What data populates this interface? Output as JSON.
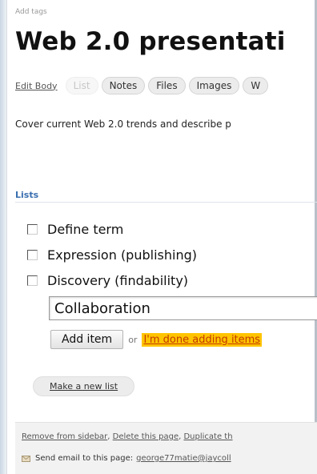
{
  "header": {
    "add_tags_label": "Add tags",
    "page_title": "Web 2.0 presentati"
  },
  "tabs": {
    "edit_body": "Edit Body",
    "items": [
      {
        "label": "List",
        "active": false
      },
      {
        "label": "Notes",
        "active": true
      },
      {
        "label": "Files",
        "active": true
      },
      {
        "label": "Images",
        "active": true
      },
      {
        "label": "W",
        "active": true
      }
    ]
  },
  "body": {
    "description": "Cover current Web 2.0 trends and describe p"
  },
  "lists": {
    "heading": "Lists",
    "items": [
      {
        "label": "Define term",
        "checked": false
      },
      {
        "label": "Expression (publishing)",
        "checked": false
      },
      {
        "label": "Discovery (findability)",
        "checked": false
      }
    ],
    "new_item_value": "Collaboration",
    "add_item_label": "Add item",
    "or_label": "or",
    "done_label": "I'm done adding items",
    "new_list_label": "Make a new list"
  },
  "footer": {
    "links": [
      "Remove from sidebar",
      "Delete this page",
      "Duplicate th"
    ],
    "email_label": "Send email to this page:",
    "email_address": "george77matie@jaycoll"
  },
  "colors": {
    "lists_heading": "#3a6fb0",
    "done_highlight": "#ffc400",
    "done_text": "#c23a00"
  }
}
